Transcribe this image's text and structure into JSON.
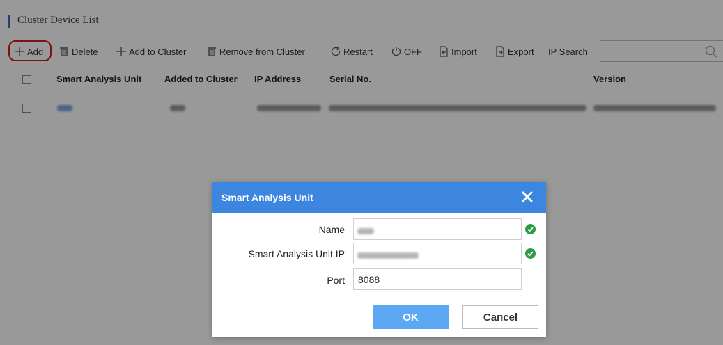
{
  "page": {
    "title": "Cluster Device List"
  },
  "toolbar": {
    "add": "Add",
    "delete": "Delete",
    "add_to_cluster": "Add to Cluster",
    "remove_from_cluster": "Remove from Cluster",
    "restart": "Restart",
    "off": "OFF",
    "import": "Import",
    "export": "Export",
    "ip_search": "IP Search"
  },
  "search": {
    "value": ""
  },
  "table": {
    "columns": [
      "Smart Analysis Unit",
      "Added to Cluster",
      "IP Address",
      "Serial No.",
      "Version"
    ]
  },
  "dialog": {
    "title": "Smart Analysis Unit",
    "fields": [
      {
        "label": "Name",
        "value": ""
      },
      {
        "label": "Smart Analysis Unit IP",
        "value": ""
      },
      {
        "label": "Port",
        "value": "8088"
      }
    ],
    "ok_label": "OK",
    "cancel_label": "Cancel"
  },
  "colors": {
    "accent": "#3d86e0",
    "ok_button": "#5da8f2",
    "valid_check": "#2e9b46",
    "highlight": "#d31f1f"
  },
  "icons": {
    "add": "plus-icon",
    "delete": "trash-icon",
    "restart": "restart-icon",
    "off": "power-icon",
    "import": "import-icon",
    "export": "export-icon",
    "search": "search-icon",
    "close": "close-icon",
    "valid": "check-circle-icon"
  }
}
